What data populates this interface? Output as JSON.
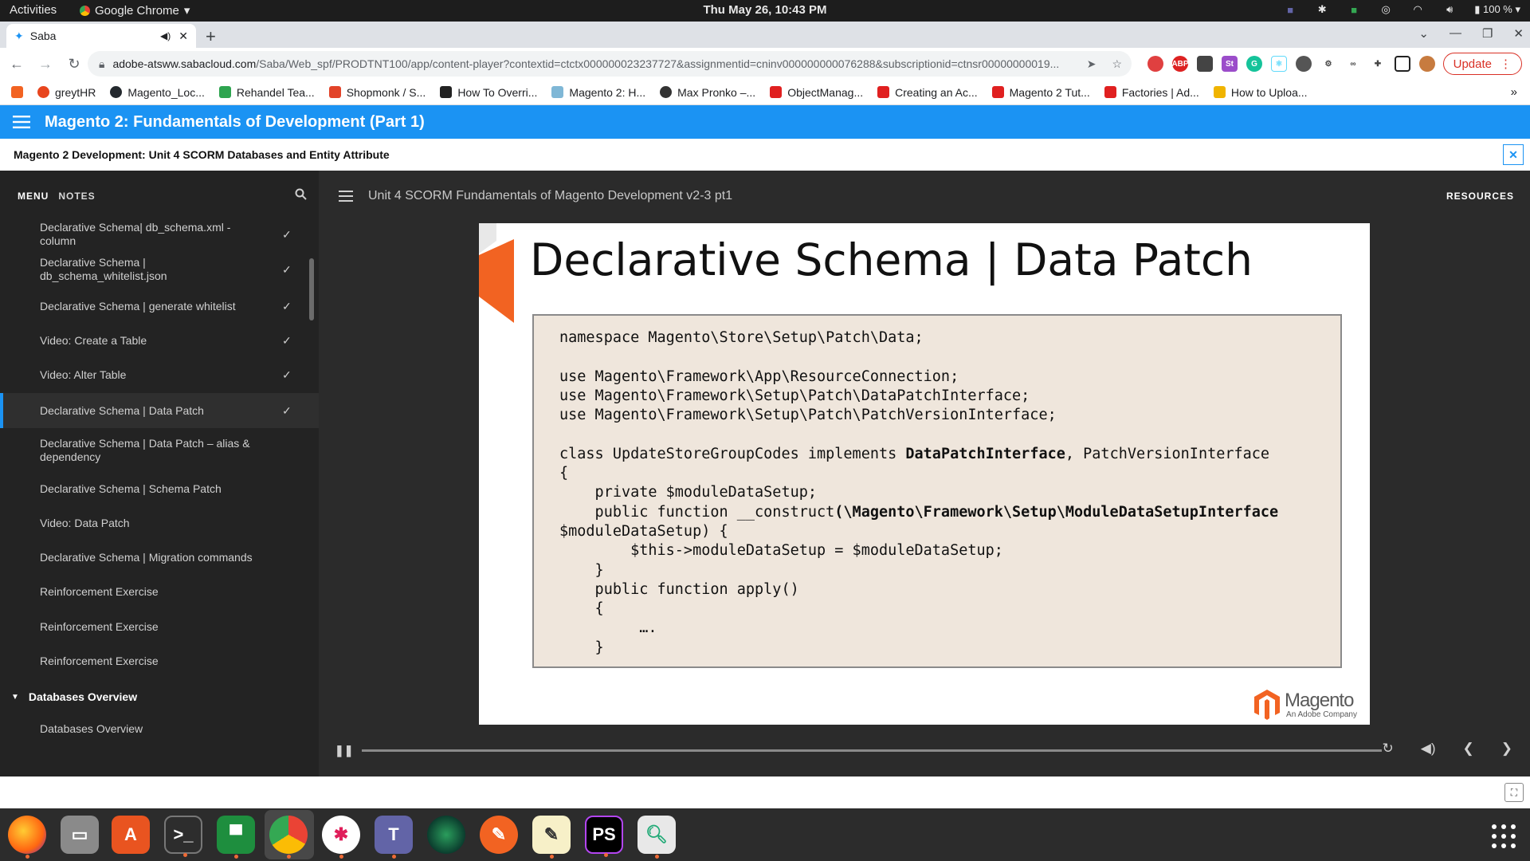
{
  "system_bar": {
    "activities": "Activities",
    "app_menu": "Google Chrome",
    "clock": "Thu May 26, 10:43 PM",
    "battery": "100 %"
  },
  "browser": {
    "tab_title": "Saba",
    "url_host": "adobe-atsww.sabacloud.com",
    "url_path": "/Saba/Web_spf/PRODTNT100/app/content-player?contextid=ctctx000000023237727&assignmentid=cninv000000000076288&subscriptionid=ctnsr00000000019...",
    "update_label": "Update",
    "bookmarks": [
      {
        "label": "greytHR",
        "color": "#e8451e"
      },
      {
        "label": "Magento_Loc...",
        "color": "#24292e"
      },
      {
        "label": "Rehandel Tea...",
        "color": "#2ea44f"
      },
      {
        "label": "Shopmonk / S...",
        "color": "#e24329"
      },
      {
        "label": "How To Overri...",
        "color": "#222222"
      },
      {
        "label": "Magento 2: H...",
        "color": "#7fb7d6"
      },
      {
        "label": "Max Pronko –...",
        "color": "#333333"
      },
      {
        "label": "ObjectManag...",
        "color": "#e02020"
      },
      {
        "label": "Creating an Ac...",
        "color": "#e02020"
      },
      {
        "label": "Magento 2 Tut...",
        "color": "#e02020"
      },
      {
        "label": "Factories | Ad...",
        "color": "#e02020"
      },
      {
        "label": "How to Uploa...",
        "color": "#f0b400"
      }
    ]
  },
  "app": {
    "header_title": "Magento 2: Fundamentals of Development (Part 1)",
    "course_title": "Magento 2 Development: Unit 4 SCORM Databases and Entity Attribute",
    "menu_tab": "MENU",
    "notes_tab": "NOTES",
    "unit_title": "Unit 4 SCORM Fundamentals of Magento Development v2-3 pt1",
    "resources": "RESOURCES",
    "menu_items": [
      {
        "label": "Declarative Schema| db_schema.xml - column",
        "done": "✓"
      },
      {
        "label": "Declarative Schema | db_schema_whitelist.json",
        "done": "✓"
      },
      {
        "label": "Declarative Schema | generate whitelist",
        "done": "✓"
      },
      {
        "label": "Video: Create a Table",
        "done": "✓"
      },
      {
        "label": "Video: Alter Table",
        "done": "✓"
      },
      {
        "label": "Declarative Schema | Data Patch",
        "done": "✓"
      },
      {
        "label": "Declarative Schema | Data Patch – alias & dependency",
        "done": ""
      },
      {
        "label": "Declarative Schema | Schema Patch",
        "done": ""
      },
      {
        "label": "Video: Data Patch",
        "done": ""
      },
      {
        "label": "Declarative Schema | Migration commands",
        "done": ""
      },
      {
        "label": "Reinforcement Exercise",
        "done": ""
      },
      {
        "label": "Reinforcement Exercise",
        "done": ""
      },
      {
        "label": "Reinforcement Exercise",
        "done": ""
      }
    ],
    "section_title": "Databases Overview",
    "section_item": "Databases Overview",
    "progress_fraction": 0.0
  },
  "slide": {
    "title": "Declarative Schema | Data Patch",
    "code": [
      {
        "pre": "namespace Magento\\Store\\Setup\\Patch\\Data;"
      },
      {
        "pre": ""
      },
      {
        "pre": "use Magento\\Framework\\App\\ResourceConnection;"
      },
      {
        "pre": "use Magento\\Framework\\Setup\\Patch\\DataPatchInterface;"
      },
      {
        "pre": "use Magento\\Framework\\Setup\\Patch\\PatchVersionInterface;"
      },
      {
        "pre": ""
      },
      {
        "pre": "class UpdateStoreGroupCodes implements ",
        "bold": "DataPatchInterface",
        "post": ", PatchVersionInterface"
      },
      {
        "pre": "{"
      },
      {
        "pre": "    private $moduleDataSetup;"
      },
      {
        "pre": "    public function __construct",
        "bold": "(\\Magento\\Framework\\Setup\\ModuleDataSetupInterface",
        "post": ""
      },
      {
        "pre": "$moduleDataSetup) {"
      },
      {
        "pre": "        $this->moduleDataSetup = $moduleDataSetup;"
      },
      {
        "pre": "    }"
      },
      {
        "pre": "    public function apply()"
      },
      {
        "pre": "    {"
      },
      {
        "pre": "         …."
      },
      {
        "pre": "    }"
      }
    ],
    "logo_word": "Magento",
    "logo_sub": "An Adobe Company"
  }
}
